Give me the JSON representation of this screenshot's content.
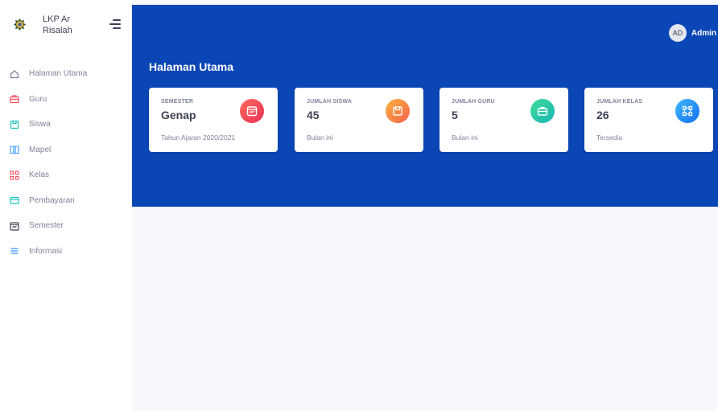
{
  "brand": {
    "title": "LKP Ar Risalah"
  },
  "sidebar": {
    "items": [
      {
        "label": "Halaman Utama",
        "icon": "home-icon",
        "color": "#7e8299"
      },
      {
        "label": "Guru",
        "icon": "briefcase-icon",
        "color": "#f64e60"
      },
      {
        "label": "Siswa",
        "icon": "save-icon",
        "color": "#1bc5bd"
      },
      {
        "label": "Mapel",
        "icon": "book-icon",
        "color": "#3699ff"
      },
      {
        "label": "Kelas",
        "icon": "grid-icon",
        "color": "#f64e60"
      },
      {
        "label": "Pembayaran",
        "icon": "card-icon",
        "color": "#1bc5bd"
      },
      {
        "label": "Semester",
        "icon": "calendar-icon",
        "color": "#3f4254"
      },
      {
        "label": "Informasi",
        "icon": "list-icon",
        "color": "#3699ff"
      }
    ]
  },
  "header": {
    "avatar_initials": "AD",
    "username": "Admin",
    "page_title": "Halaman Utama",
    "background_color": "#0a46b5"
  },
  "cards": [
    {
      "label": "SEMESTER",
      "value": "Genap",
      "sub": "Tahun Ajaran 2020/2021",
      "icon": "calendar-icon",
      "color": "#f1416c"
    },
    {
      "label": "JUMLAH SISWA",
      "value": "45",
      "sub": "Bulan ini",
      "icon": "save-icon",
      "color": "#ff8f3a"
    },
    {
      "label": "JUMLAH GURU",
      "value": "5",
      "sub": "Bulan ini",
      "icon": "briefcase-icon",
      "color": "#1bc5bd"
    },
    {
      "label": "JUMLAH KELAS",
      "value": "26",
      "sub": "Tersedia",
      "icon": "grid-icon",
      "color": "#1a9bfc"
    }
  ]
}
